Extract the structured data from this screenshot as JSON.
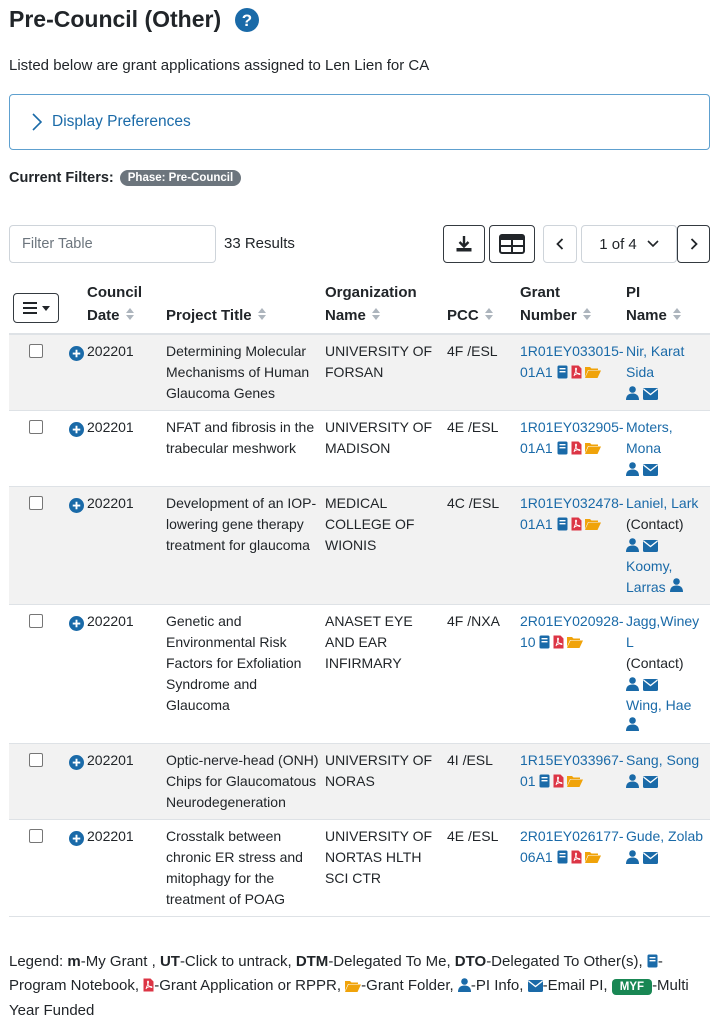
{
  "page": {
    "title": "Pre-Council (Other)",
    "subtitle": "Listed below are grant applications assigned to Len Lien for CA",
    "display_prefs": "Display Preferences",
    "filters_label": "Current Filters:",
    "filter_pill": "Phase: Pre-Council"
  },
  "toolbar": {
    "filter_placeholder": "Filter Table",
    "results": "33 Results",
    "page_label": "1 of 4"
  },
  "table": {
    "headers": {
      "council_date_1": "Council",
      "council_date_2": "Date",
      "project_title": "Project Title",
      "org_1": "Organization",
      "org_2": "Name",
      "pcc": "PCC",
      "grant_1": "Grant",
      "grant_2": "Number",
      "pi_1": "PI",
      "pi_2": "Name"
    },
    "rows": [
      {
        "date": "202201",
        "title": "Determining Molecular Mechanisms of Human Glaucoma Genes",
        "org": "UNIVERSITY OF FORSAN",
        "pcc": "4F /ESL",
        "grant_a": "1R01EY033015-",
        "grant_b": "01A1",
        "pi1": "Nir, Karat Sida",
        "pi1_note": "",
        "pi2": ""
      },
      {
        "date": "202201",
        "title": "NFAT and fibrosis in the trabecular meshwork",
        "org": "UNIVERSITY OF MADISON",
        "pcc": "4E /ESL",
        "grant_a": "1R01EY032905-",
        "grant_b": "01A1",
        "pi1": "Moters, Mona",
        "pi1_note": "",
        "pi2": ""
      },
      {
        "date": "202201",
        "title": "Development of an IOP-lowering gene therapy treatment for glaucoma",
        "org": "MEDICAL COLLEGE OF WIONIS",
        "pcc": "4C /ESL",
        "grant_a": "1R01EY032478-",
        "grant_b": "01A1",
        "pi1": "Laniel, Lark",
        "pi1_note": "(Contact)",
        "pi2": "Koomy, Larras"
      },
      {
        "date": "202201",
        "title": "Genetic and Environmental Risk Factors for Exfoliation Syndrome and Glaucoma",
        "org": "ANASET EYE AND EAR INFIRMARY",
        "pcc": "4F /NXA",
        "grant_a": "2R01EY020928-",
        "grant_b": "10",
        "pi1": "Jagg,Winey L",
        "pi1_note": "(Contact)",
        "pi2": "Wing, Hae"
      },
      {
        "date": "202201",
        "title": "Optic-nerve-head (ONH) Chips for Glaucomatous Neurodegeneration",
        "org": "UNIVERSITY OF NORAS",
        "pcc": "4I /ESL",
        "grant_a": "1R15EY033967-",
        "grant_b": "01",
        "pi1": "Sang, Song",
        "pi1_note": "",
        "pi2": ""
      },
      {
        "date": "202201",
        "title": "Crosstalk between chronic ER stress and mitophagy for the treatment of POAG",
        "org": "UNIVERSITY OF NORTAS HLTH SCI CTR",
        "pcc": "4E /ESL",
        "grant_a": "2R01EY026177-",
        "grant_b": "06A1",
        "pi1": "Gude, Zolab",
        "pi1_note": "",
        "pi2": ""
      }
    ]
  },
  "legend": {
    "label": "Legend:",
    "m": "m",
    "m_text": "-My Grant ,",
    "ut": "UT",
    "ut_text": "-Click to untrack,",
    "dtm": "DTM",
    "dtm_text": "-Delegated To Me,",
    "dto": "DTO",
    "dto_text": "-Delegated To Other(s),",
    "notebook_text": "-Program Notebook,",
    "pdf_text": "-Grant Application or RPPR,",
    "folder_text": "-Grant Folder,",
    "pi_text": "-PI Info,",
    "email_text": "-Email PI,",
    "myf": "MYF",
    "myf_text": "-Multi Year Funded"
  },
  "colors": {
    "link": "#1a6aa8",
    "notebook": "#1a6aa8",
    "pdf": "#dc3545",
    "folder": "#f0a30a",
    "myf": "#198754"
  },
  "icons": [
    "question-circle-icon",
    "chevron-right-icon",
    "download-icon",
    "table-icon",
    "chevron-left-icon",
    "chevron-down-icon",
    "plus-circle-icon",
    "notebook-icon",
    "pdf-icon",
    "folder-icon",
    "person-icon",
    "envelope-icon",
    "hamburger-icon",
    "sort-icon"
  ]
}
